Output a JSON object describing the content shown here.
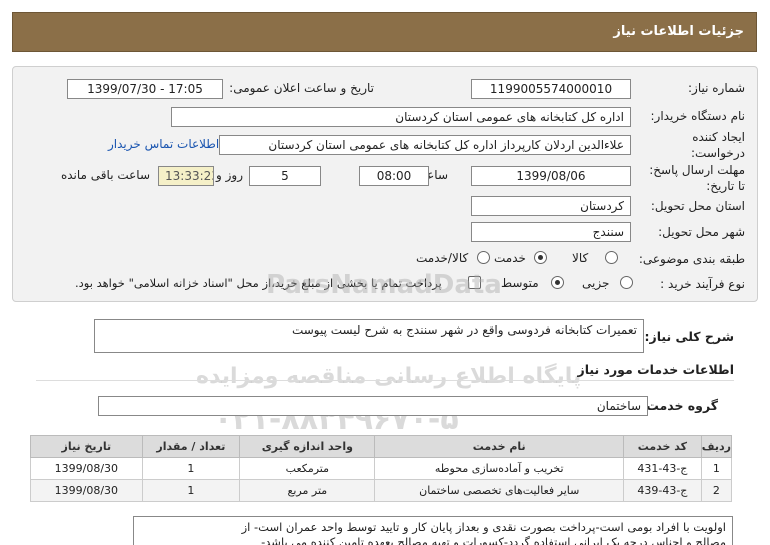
{
  "header": {
    "title": "جزئیات اطلاعات نیاز"
  },
  "form": {
    "need_number_label": "شماره نیاز:",
    "need_number": "1199005574000010",
    "announce_label": "تاریخ و ساعت اعلان عمومی:",
    "announce_value": "1399/07/30 - 17:05",
    "buyer_label": "نام دستگاه خریدار:",
    "buyer_value": "اداره کل کتابخانه های عمومی استان کردستان",
    "creator_label_1": "ایجاد کننده",
    "creator_label_2": "درخواست:",
    "creator_value": "علاءالدین اردلان کارپرداز اداره کل کتابخانه های عمومی استان کردستان",
    "contact_link": "اطلاعات تماس خریدار",
    "deadline_label_1": "مهلت ارسال پاسخ:",
    "deadline_label_2": "تا تاریخ:",
    "deadline_date": "1399/08/06",
    "time_label": "ساعت",
    "deadline_time": "08:00",
    "days_value": "5",
    "days_label": "روز و",
    "remaining_time": "13:33:23",
    "remaining_label": "ساعت باقی مانده",
    "province_label": "استان محل تحویل:",
    "province_value": "کردستان",
    "city_label": "شهر محل تحویل:",
    "city_value": "سنندج",
    "category_label": "طبقه بندی موضوعی:",
    "category_options": [
      "کالا",
      "خدمت",
      "کالا/خدمت"
    ],
    "category_selected": "خدمت",
    "process_label": "نوع فرآیند خرید :",
    "process_options": [
      "جزیی",
      "متوسط"
    ],
    "process_selected": "متوسط",
    "payment_note": "پرداخت تمام یا بخشی از مبلغ خرید،از محل \"اسناد خزانه اسلامی\" خواهد بود."
  },
  "summary": {
    "label": "شرح کلی نیاز:",
    "value": "تعمیرات کتابخانه فردوسی واقع در شهر سنندج به شرح لیست پیوست"
  },
  "services_section": {
    "title": "اطلاعات خدمات مورد نیاز"
  },
  "service_group": {
    "label": "گروه خدمت:",
    "value": "ساختمان"
  },
  "table": {
    "headers": [
      "ردیف",
      "کد خدمت",
      "نام خدمت",
      "واحد اندازه گیری",
      "تعداد / مقدار",
      "تاریخ نیاز"
    ],
    "rows": [
      [
        "1",
        "ج-43-431",
        "تخریب و آماده‌سازی محوطه",
        "مترمکعب",
        "1",
        "1399/08/30"
      ],
      [
        "2",
        "ج-43-439",
        "سایر فعالیت‌های تخصصی ساختمان",
        "متر مربع",
        "1",
        "1399/08/30"
      ]
    ]
  },
  "notes": {
    "line1": "اولویت با افراد بومی است-پرداخت بصورت نقدی و بعداز پایان کار و تایید توسط واحد عمران است- از",
    "line2": "مصالح و اجناس درجه یک ایرانی استفاده گردد-کسورات و تهیه مصالح بعهده تامین کننده می باشد-"
  },
  "watermark": {
    "line1": "ParsNamadData",
    "line2": "مرکز فراوری اطلاعات پارس نماد داده ها",
    "line3": "پایگاه اطلاع رسانی مناقصه ومزایده",
    "line4": "۰۲۱-۸۸۳۴۹۶۷۰-۵"
  }
}
